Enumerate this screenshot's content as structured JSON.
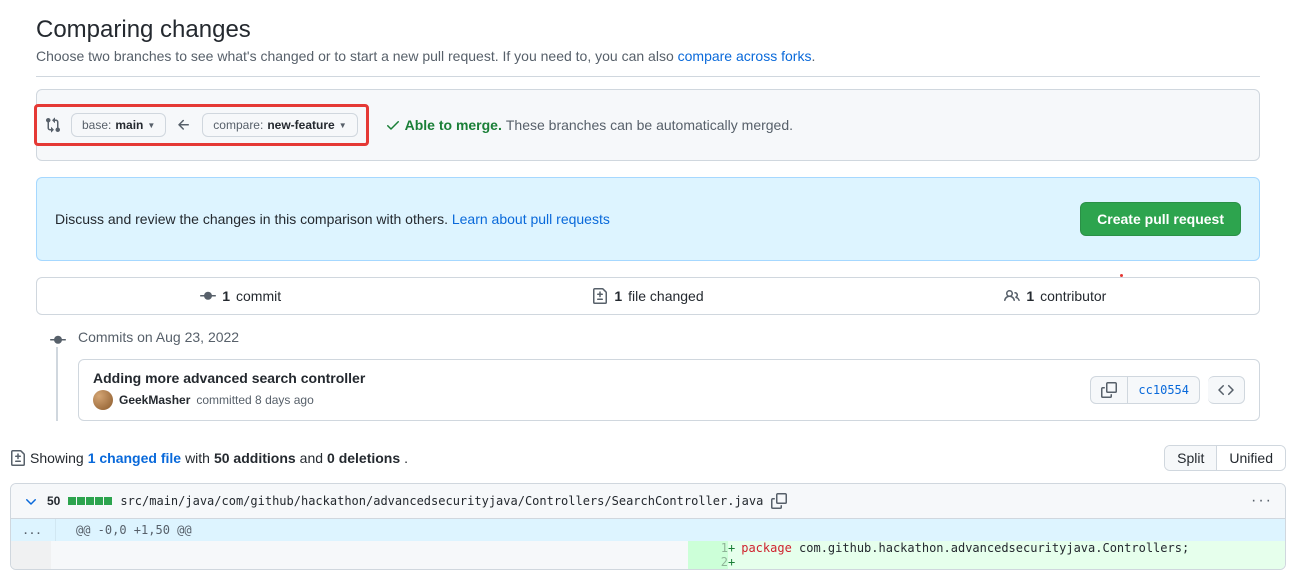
{
  "header": {
    "title": "Comparing changes",
    "subtitle_pre": "Choose two branches to see what's changed or to start a new pull request. If you need to, you can also ",
    "subtitle_link": "compare across forks",
    "subtitle_post": "."
  },
  "range": {
    "base_label": "base: ",
    "base_branch": "main",
    "compare_label": "compare: ",
    "compare_branch": "new-feature",
    "merge_status": "Able to merge.",
    "merge_sub": "These branches can be automatically merged."
  },
  "discuss": {
    "text_pre": "Discuss and review the changes in this comparison with others. ",
    "link": "Learn about pull requests",
    "button": "Create pull request"
  },
  "stats": {
    "commits_num": "1",
    "commits_label": "commit",
    "files_num": "1",
    "files_label": "file changed",
    "contrib_num": "1",
    "contrib_label": "contributor"
  },
  "timeline": {
    "date_label": "Commits on Aug 23, 2022",
    "commit_title": "Adding more advanced search controller",
    "author": "GeekMasher",
    "committed": "committed 8 days ago",
    "sha": "cc10554"
  },
  "showing": {
    "pre": "Showing ",
    "link": "1 changed file",
    "mid": " with ",
    "additions": "50 additions",
    "and": " and ",
    "deletions": "0 deletions",
    "post": ".",
    "split": "Split",
    "unified": "Unified"
  },
  "file": {
    "count": "50",
    "path": "src/main/java/com/github/hackathon/advancedsecurityjava/Controllers/SearchController.java",
    "hunk": "@@ -0,0 +1,50 @@",
    "line1_num": "1",
    "line1_kw": "package",
    "line1_rest": " com.github.hackathon.advancedsecurityjava.Controllers;",
    "line2_num": "2"
  }
}
